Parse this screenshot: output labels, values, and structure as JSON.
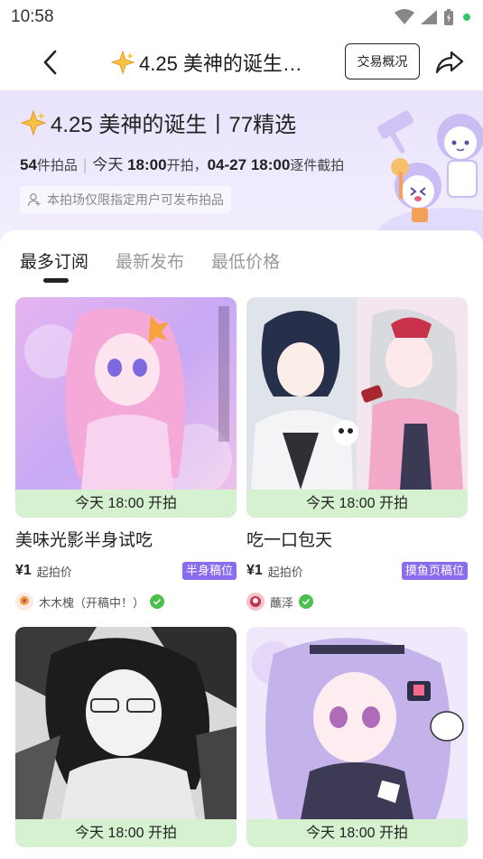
{
  "status_bar": {
    "time": "10:58"
  },
  "nav": {
    "title": "4.25 美神的诞生…",
    "overview_label": "交易概况"
  },
  "banner": {
    "title": "4.25 美神的诞生丨77精选",
    "count": "54",
    "count_unit": "件拍品",
    "start_day": "今天",
    "start_time": "18:00",
    "start_suffix": "开拍，",
    "end_date": "04-27",
    "end_time": "18:00",
    "end_suffix": "逐件截拍",
    "note": "本拍场仅限指定用户可发布拍品"
  },
  "tabs": [
    "最多订阅",
    "最新发布",
    "最低价格"
  ],
  "cards": [
    {
      "time_label": "今天 18:00 开拍",
      "title": "美味光影半身试吃",
      "price": "¥1",
      "price_label": "起拍价",
      "tag": "半身稿位",
      "seller": "木木槐（开稿中！）",
      "palette": [
        "#f3c6ee",
        "#c8b6f6",
        "#b56ee0"
      ]
    },
    {
      "time_label": "今天 18:00 开拍",
      "title": "吃一口包天",
      "price": "¥1",
      "price_label": "起拍价",
      "tag": "摸鱼页稿位",
      "seller": "蘸泽",
      "palette": [
        "#f7d6e6",
        "#3b3f55",
        "#e15a7a"
      ]
    },
    {
      "time_label": "今天 18:00 开拍",
      "palette": [
        "#dcdcdc",
        "#8a8a8a",
        "#222222"
      ]
    },
    {
      "time_label": "今天 18:00 开拍",
      "palette": [
        "#efe3fb",
        "#b9a4e6",
        "#6a5a9a"
      ]
    }
  ],
  "colors": {
    "accent_purple": "#8a6cf0",
    "time_bar_green": "#d6f1cf",
    "banner_bg": "#ece6fc",
    "verified_green": "#4cc04c"
  }
}
